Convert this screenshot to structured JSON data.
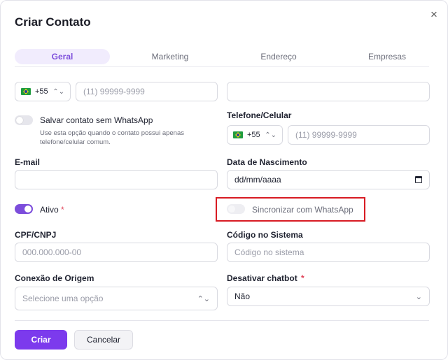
{
  "dialog": {
    "title": "Criar Contato",
    "close_icon": "×"
  },
  "tabs": [
    {
      "label": "Geral",
      "active": true
    },
    {
      "label": "Marketing",
      "active": false
    },
    {
      "label": "Endereço",
      "active": false
    },
    {
      "label": "Empresas",
      "active": false
    }
  ],
  "phone_primary": {
    "country_code": "+55",
    "placeholder": "(11) 99999-9999"
  },
  "name_field": {
    "value": ""
  },
  "whatsapp_optout": {
    "label": "Salvar contato sem WhatsApp",
    "help": "Use esta opção quando o contato possui apenas telefone/celular comum."
  },
  "telefone": {
    "label": "Telefone/Celular",
    "country_code": "+55",
    "placeholder": "(11) 99999-9999"
  },
  "email": {
    "label": "E-mail",
    "value": ""
  },
  "birth": {
    "label": "Data de Nascimento",
    "placeholder": "dd/mm/aaaa"
  },
  "ativo": {
    "label": "Ativo",
    "required_mark": "*",
    "enabled": true
  },
  "sync_whatsapp": {
    "label": "Sincronizar com WhatsApp",
    "enabled": false
  },
  "cpf": {
    "label": "CPF/CNPJ",
    "placeholder": "000.000.000-00"
  },
  "codigo": {
    "label": "Código no Sistema",
    "placeholder": "Código no sistema"
  },
  "conexao": {
    "label": "Conexão de Origem",
    "placeholder": "Selecione uma opção"
  },
  "chatbot": {
    "label": "Desativar chatbot",
    "required_mark": "*",
    "value": "Não"
  },
  "actions": {
    "create": "Criar",
    "cancel": "Cancelar"
  },
  "colors": {
    "accent": "#7c3aed",
    "highlight": "#d81b23"
  }
}
